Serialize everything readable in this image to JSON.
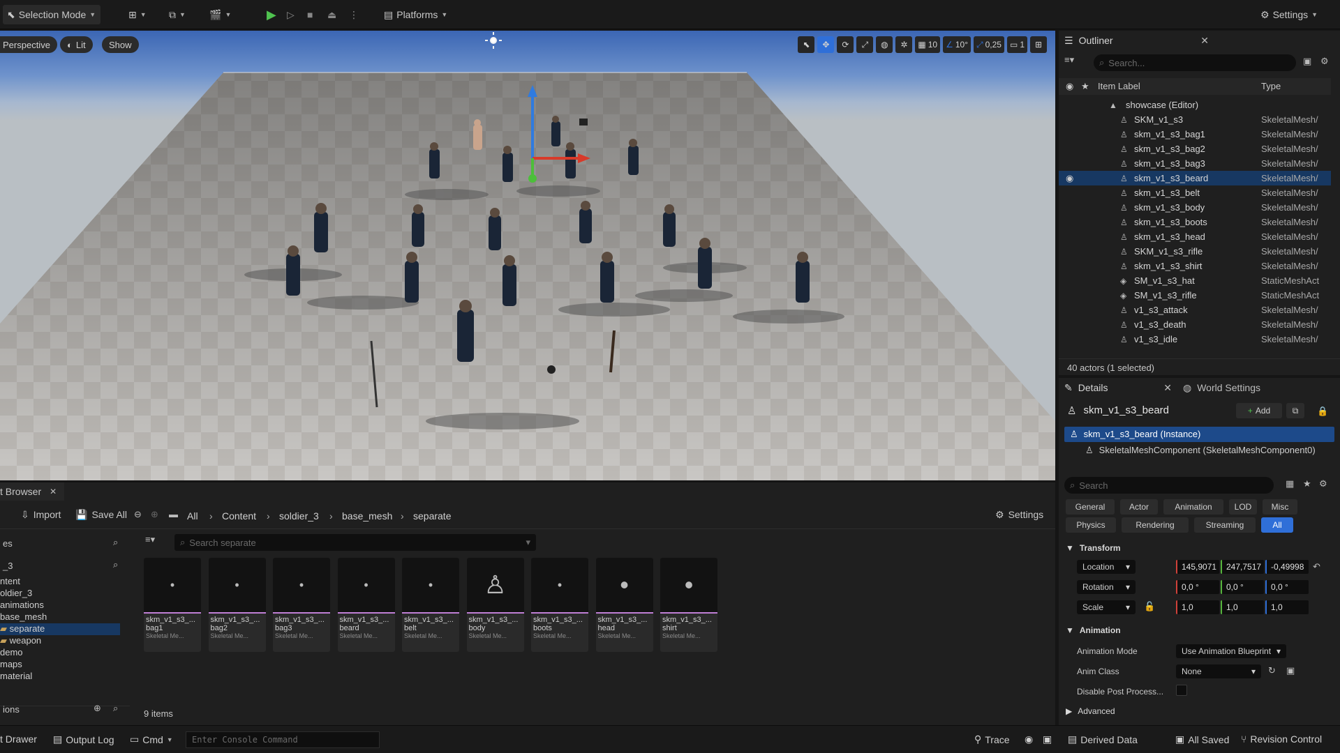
{
  "toolbar": {
    "mode": "Selection Mode",
    "platforms": "Platforms",
    "settings": "Settings"
  },
  "viewport": {
    "perspective": "Perspective",
    "lit": "Lit",
    "show": "Show",
    "grid": "10",
    "angle": "10°",
    "scale": "0,25",
    "camera": "1"
  },
  "outliner": {
    "title": "Outliner",
    "search_placeholder": "Search...",
    "col_label": "Item Label",
    "col_type": "Type",
    "world": "showcase (Editor)",
    "rows": [
      {
        "label": "SKM_v1_s3",
        "type": "SkeletalMesh/"
      },
      {
        "label": "skm_v1_s3_bag1",
        "type": "SkeletalMesh/"
      },
      {
        "label": "skm_v1_s3_bag2",
        "type": "SkeletalMesh/"
      },
      {
        "label": "skm_v1_s3_bag3",
        "type": "SkeletalMesh/"
      },
      {
        "label": "skm_v1_s3_beard",
        "type": "SkeletalMesh/"
      },
      {
        "label": "skm_v1_s3_belt",
        "type": "SkeletalMesh/"
      },
      {
        "label": "skm_v1_s3_body",
        "type": "SkeletalMesh/"
      },
      {
        "label": "skm_v1_s3_boots",
        "type": "SkeletalMesh/"
      },
      {
        "label": "skm_v1_s3_head",
        "type": "SkeletalMesh/"
      },
      {
        "label": "SKM_v1_s3_rifle",
        "type": "SkeletalMesh/"
      },
      {
        "label": "skm_v1_s3_shirt",
        "type": "SkeletalMesh/"
      },
      {
        "label": "SM_v1_s3_hat",
        "type": "StaticMeshAct"
      },
      {
        "label": "SM_v1_s3_rifle",
        "type": "StaticMeshAct"
      },
      {
        "label": "v1_s3_attack",
        "type": "SkeletalMesh/"
      },
      {
        "label": "v1_s3_death",
        "type": "SkeletalMesh/"
      },
      {
        "label": "v1_s3_idle",
        "type": "SkeletalMesh/"
      }
    ],
    "count": "40 actors (1 selected)"
  },
  "details": {
    "title": "Details",
    "world_settings": "World Settings",
    "actor": "skm_v1_s3_beard",
    "add": "Add",
    "instance": "skm_v1_s3_beard (Instance)",
    "component": "SkeletalMeshComponent (SkeletalMeshComponent0)",
    "search_placeholder": "Search",
    "cats": [
      "General",
      "Actor",
      "Animation",
      "LOD",
      "Misc"
    ],
    "cats2": [
      "Physics",
      "Rendering",
      "Streaming",
      "All"
    ],
    "transform": "Transform",
    "location": "Location",
    "rotation": "Rotation",
    "scale": "Scale",
    "loc": [
      "145,9071",
      "247,7517",
      "-0,49998"
    ],
    "rot": [
      "0,0 °",
      "0,0 °",
      "0,0 °"
    ],
    "scl": [
      "1,0",
      "1,0",
      "1,0"
    ],
    "animation": "Animation",
    "anim_mode_label": "Animation Mode",
    "anim_mode": "Use Animation Blueprint",
    "anim_class_label": "Anim Class",
    "anim_class": "None",
    "disable_pp": "Disable Post Process...",
    "advanced": "Advanced"
  },
  "cb": {
    "tab": "t Browser",
    "import": "Import",
    "save_all": "Save All",
    "crumbs": [
      "All",
      "Content",
      "soldier_3",
      "base_mesh",
      "separate"
    ],
    "settings": "Settings",
    "search_placeholder": "Search separate",
    "left_search": "es",
    "left_filter": "_3",
    "tree": [
      "ntent",
      "oldier_3",
      "animations",
      "base_mesh",
      "separate",
      "weapon",
      "demo",
      "maps",
      "material"
    ],
    "collections": "ions",
    "items": "9 items",
    "tiles": [
      {
        "n1": "skm_v1_s3_...",
        "n2": "bag1",
        "n3": "Skeletal Me..."
      },
      {
        "n1": "skm_v1_s3_...",
        "n2": "bag2",
        "n3": "Skeletal Me..."
      },
      {
        "n1": "skm_v1_s3_...",
        "n2": "bag3",
        "n3": "Skeletal Me..."
      },
      {
        "n1": "skm_v1_s3_...",
        "n2": "beard",
        "n3": "Skeletal Me..."
      },
      {
        "n1": "skm_v1_s3_...",
        "n2": "belt",
        "n3": "Skeletal Me..."
      },
      {
        "n1": "skm_v1_s3_...",
        "n2": "body",
        "n3": "Skeletal Me..."
      },
      {
        "n1": "skm_v1_s3_...",
        "n2": "boots",
        "n3": "Skeletal Me..."
      },
      {
        "n1": "skm_v1_s3_...",
        "n2": "head",
        "n3": "Skeletal Me..."
      },
      {
        "n1": "skm_v1_s3_...",
        "n2": "shirt",
        "n3": "Skeletal Me..."
      }
    ]
  },
  "status": {
    "drawer": "t Drawer",
    "output_log": "Output Log",
    "cmd": "Cmd",
    "console_placeholder": "Enter Console Command",
    "trace": "Trace",
    "derived": "Derived Data",
    "all_saved": "All Saved",
    "revision": "Revision Control"
  }
}
